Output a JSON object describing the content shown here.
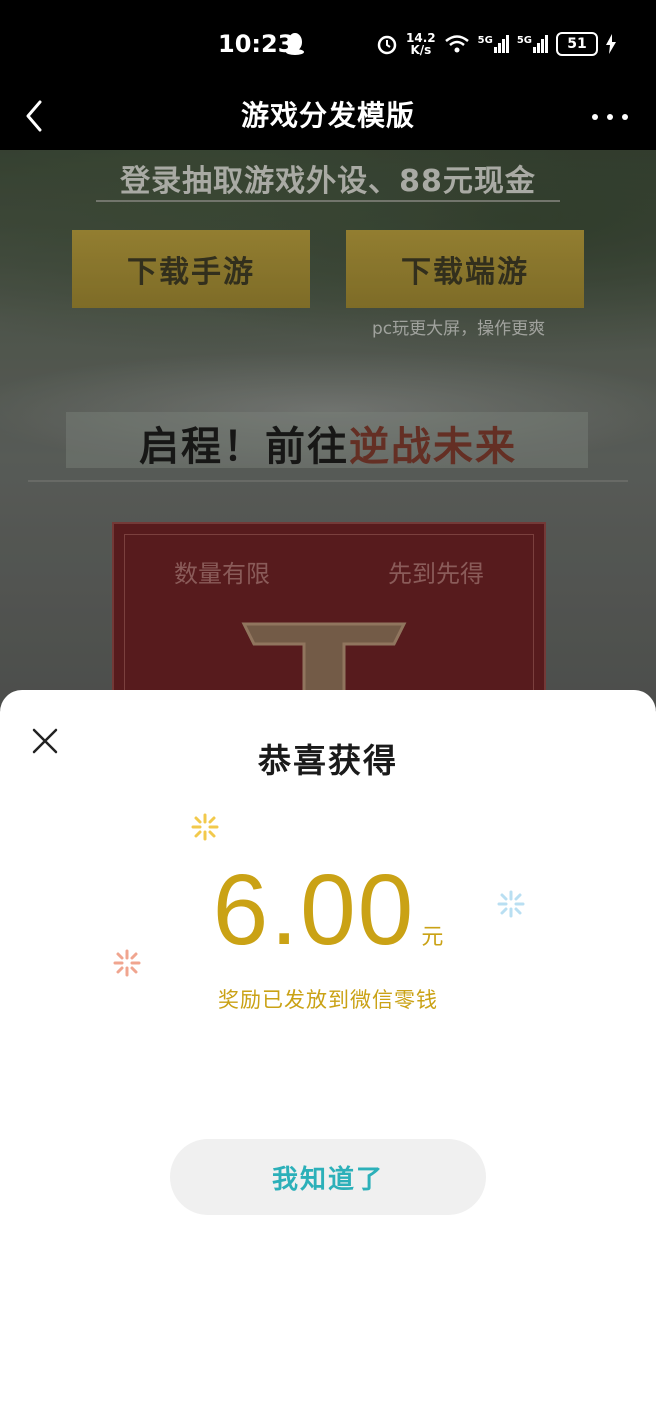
{
  "status_bar": {
    "time": "10:23",
    "net_speed_value": "14.2",
    "net_speed_unit": "K/s",
    "signal_1": "5G",
    "signal_2": "5G",
    "battery": "51"
  },
  "title_bar": {
    "title": "游戏分发模版"
  },
  "background_page": {
    "headline": "登录抽取游戏外设、88元现金",
    "download_mobile": "下载手游",
    "download_pc": "下载端游",
    "pc_note": "pc玩更大屏，操作更爽",
    "slogan_prefix": "启程！前往",
    "slogan_highlight": "逆战未来",
    "card_left": "数量有限",
    "card_right": "先到先得"
  },
  "sheet": {
    "title": "恭喜获得",
    "amount": "6.00",
    "unit": "元",
    "note": "奖励已发放到微信零钱",
    "ok_label": "我知道了"
  },
  "colors": {
    "accent_gold": "#caa215",
    "button_text": "#2cb0b9",
    "button_bg": "#f0f0f0"
  }
}
